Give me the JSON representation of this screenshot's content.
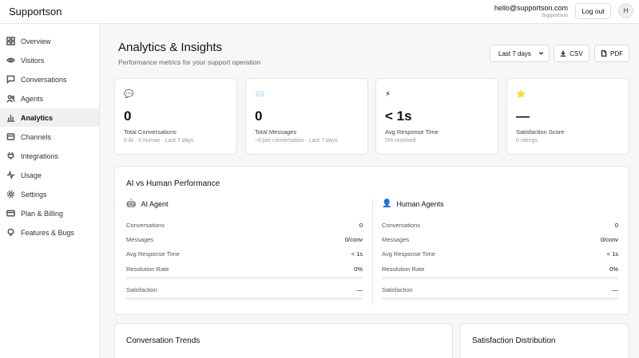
{
  "app": {
    "brand": "Supportson"
  },
  "user": {
    "email": "hello@supportson.com",
    "org": "Supportson",
    "avatar_initial": "H",
    "logout_label": "Log out"
  },
  "sidebar": {
    "items": [
      {
        "label": "Overview",
        "icon": "grid-icon",
        "active": false
      },
      {
        "label": "Visitors",
        "icon": "eye-icon",
        "active": false
      },
      {
        "label": "Conversations",
        "icon": "chat-bubble-icon",
        "active": false
      },
      {
        "label": "Agents",
        "icon": "users-icon",
        "active": false
      },
      {
        "label": "Analytics",
        "icon": "bar-chart-icon",
        "active": true
      },
      {
        "label": "Channels",
        "icon": "channels-icon",
        "active": false
      },
      {
        "label": "Integrations",
        "icon": "plug-icon",
        "active": false
      },
      {
        "label": "Usage",
        "icon": "activity-icon",
        "active": false
      },
      {
        "label": "Settings",
        "icon": "gear-icon",
        "active": false
      },
      {
        "label": "Plan & Billing",
        "icon": "credit-card-icon",
        "active": false
      },
      {
        "label": "Features & Bugs",
        "icon": "lightbulb-icon",
        "active": false
      }
    ]
  },
  "header": {
    "title": "Analytics & Insights",
    "subtitle": "Performance metrics for your support operation",
    "range_value": "Last 7 days",
    "csv_label": "CSV",
    "pdf_label": "PDF"
  },
  "stats": [
    {
      "icon": "💬",
      "value": "0",
      "label": "Total Conversations",
      "sub": "0 AI · 0 human · Last 7 days"
    },
    {
      "icon": "📨",
      "value": "0",
      "label": "Total Messages",
      "sub": "~0 per conversation · Last 7 days"
    },
    {
      "icon": "⚡",
      "value": "< 1s",
      "label": "Avg Response Time",
      "sub": "0% resolved"
    },
    {
      "icon": "⭐",
      "value": "—",
      "label": "Satisfaction Score",
      "sub": "0 ratings"
    }
  ],
  "performance": {
    "title": "AI vs Human Performance",
    "ai": {
      "icon": "🤖",
      "title": "AI Agent",
      "rows": [
        {
          "label": "Conversations",
          "value": "0"
        },
        {
          "label": "Messages",
          "value": "0/conv"
        },
        {
          "label": "Avg Response Time",
          "value": "< 1s"
        },
        {
          "label": "Resolution Rate",
          "value": "0%"
        },
        {
          "label": "Satisfaction",
          "value": "—"
        }
      ],
      "resolution_fill": 0,
      "satisfaction_fill": 0
    },
    "human": {
      "icon": "👤",
      "title": "Human Agents",
      "rows": [
        {
          "label": "Conversations",
          "value": "0"
        },
        {
          "label": "Messages",
          "value": "0/conv"
        },
        {
          "label": "Avg Response Time",
          "value": "< 1s"
        },
        {
          "label": "Resolution Rate",
          "value": "0%"
        },
        {
          "label": "Satisfaction",
          "value": "—"
        }
      ],
      "resolution_fill": 0,
      "satisfaction_fill": 0
    }
  },
  "bottom": {
    "trends_title": "Conversation Trends",
    "satisfaction_title": "Satisfaction Distribution"
  }
}
